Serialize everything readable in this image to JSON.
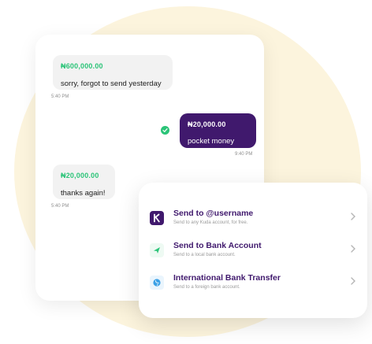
{
  "messages": [
    {
      "direction": "incoming",
      "amount": "₦600,000.00",
      "text": "sorry, forgot to send yesterday",
      "time": "5:40 PM"
    },
    {
      "direction": "outgoing",
      "amount": "₦20,000.00",
      "text": "pocket money",
      "time": "9:40 PM"
    },
    {
      "direction": "incoming",
      "amount": "₦20,000.00",
      "text": "thanks again!",
      "time": "5:40 PM"
    }
  ],
  "options": [
    {
      "title": "Send to @username",
      "subtitle": "Send to any Kuda account, for free.",
      "icon": "kuda-logo-icon"
    },
    {
      "title": "Send to Bank Account",
      "subtitle": "Send to a local bank account.",
      "icon": "send-arrow-icon"
    },
    {
      "title": "International Bank Transfer",
      "subtitle": "Send to a foreign bank account.",
      "icon": "globe-icon"
    }
  ],
  "colors": {
    "brand_purple": "#40196d",
    "money_green": "#2bc478",
    "background_cream": "#fcf4dd"
  }
}
